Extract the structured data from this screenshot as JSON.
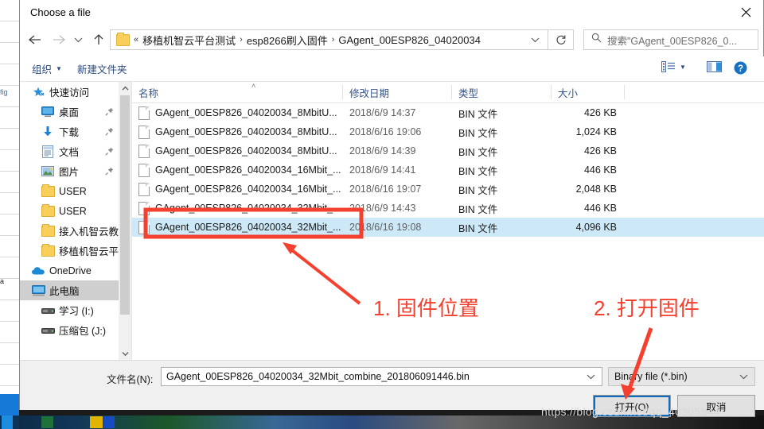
{
  "window": {
    "title": "Choose a file",
    "close_icon": "close-icon"
  },
  "nav": {
    "back_icon": "arrow-left-icon",
    "forward_icon": "arrow-right-icon",
    "history_icon": "chevron-down-icon",
    "up_icon": "arrow-up-icon",
    "refresh_icon": "refresh-icon",
    "breadcrumb": {
      "overflow": "«",
      "items": [
        "移植机智云平台测试",
        "esp8266刷入固件",
        "GAgent_00ESP826_04020034"
      ],
      "separator": "›",
      "dropdown_icon": "chevron-down-icon"
    },
    "search": {
      "icon": "search-icon",
      "text": "搜索\"GAgent_00ESP826_0..."
    }
  },
  "toolbar": {
    "organize": "组织",
    "organize_caret": "▼",
    "new_folder": "新建文件夹",
    "view_icon": "view-options-icon",
    "view_caret": "▼",
    "preview_pane_icon": "preview-pane-icon",
    "help_icon": "help-icon"
  },
  "sidebar": {
    "scrollbar": {
      "up_icon": "chevron-up-icon",
      "down_icon": "chevron-down-icon"
    },
    "items": [
      {
        "label": "快速访问",
        "icon": "quick-access-star-icon",
        "indent": 0,
        "pinned": false,
        "selected": false
      },
      {
        "label": "桌面",
        "icon": "desktop-icon",
        "indent": 1,
        "pinned": true,
        "selected": false
      },
      {
        "label": "下载",
        "icon": "downloads-icon",
        "indent": 1,
        "pinned": true,
        "selected": false
      },
      {
        "label": "文档",
        "icon": "documents-icon",
        "indent": 1,
        "pinned": true,
        "selected": false
      },
      {
        "label": "图片",
        "icon": "pictures-icon",
        "indent": 1,
        "pinned": true,
        "selected": false
      },
      {
        "label": "USER",
        "icon": "folder-icon",
        "indent": 1,
        "pinned": false,
        "selected": false
      },
      {
        "label": "USER",
        "icon": "folder-icon",
        "indent": 1,
        "pinned": false,
        "selected": false
      },
      {
        "label": "接入机智云教程",
        "icon": "folder-icon",
        "indent": 1,
        "pinned": false,
        "selected": false
      },
      {
        "label": "移植机智云平台测",
        "icon": "folder-icon",
        "indent": 1,
        "pinned": false,
        "selected": false
      },
      {
        "label": "OneDrive",
        "icon": "onedrive-cloud-icon",
        "indent": 0,
        "pinned": false,
        "selected": false
      },
      {
        "label": "此电脑",
        "icon": "this-pc-icon",
        "indent": 0,
        "pinned": false,
        "selected": true
      },
      {
        "label": "学习 (I:)",
        "icon": "drive-icon",
        "indent": 1,
        "pinned": false,
        "selected": false
      },
      {
        "label": "压缩包 (J:)",
        "icon": "drive-icon",
        "indent": 1,
        "pinned": false,
        "selected": false
      }
    ]
  },
  "filelist": {
    "columns": [
      "名称",
      "修改日期",
      "类型",
      "大小"
    ],
    "sort_caret": "˄",
    "rows": [
      {
        "name": "GAgent_00ESP826_04020034_8MbitU...",
        "date": "2018/6/9 14:37",
        "type": "BIN 文件",
        "size": "426 KB",
        "selected": false
      },
      {
        "name": "GAgent_00ESP826_04020034_8MbitU...",
        "date": "2018/6/16 19:06",
        "type": "BIN 文件",
        "size": "1,024 KB",
        "selected": false
      },
      {
        "name": "GAgent_00ESP826_04020034_8MbitU...",
        "date": "2018/6/9 14:39",
        "type": "BIN 文件",
        "size": "426 KB",
        "selected": false
      },
      {
        "name": "GAgent_00ESP826_04020034_16Mbit_...",
        "date": "2018/6/9 14:41",
        "type": "BIN 文件",
        "size": "446 KB",
        "selected": false
      },
      {
        "name": "GAgent_00ESP826_04020034_16Mbit_...",
        "date": "2018/6/16 19:07",
        "type": "BIN 文件",
        "size": "2,048 KB",
        "selected": false
      },
      {
        "name": "GAgent_00ESP826_04020034_32Mbit_...",
        "date": "2018/6/9 14:43",
        "type": "BIN 文件",
        "size": "446 KB",
        "selected": false
      },
      {
        "name": "GAgent_00ESP826_04020034_32Mbit_...",
        "date": "2018/6/16 19:08",
        "type": "BIN 文件",
        "size": "4,096 KB",
        "selected": true
      }
    ]
  },
  "bottom": {
    "filename_label": "文件名(N):",
    "filename_value": "GAgent_00ESP826_04020034_32Mbit_combine_201806091446.bin",
    "filename_caret": "chevron-down-icon",
    "filetype_value": "Binary file (*.bin)",
    "filetype_caret": "chevron-down-icon",
    "open_button": "打开(O)",
    "cancel_button": "取消"
  },
  "annotations": {
    "note1": "1. 固件位置",
    "note2": "2. 打开固件",
    "accent_color": "#f4402e"
  },
  "watermark": "https://blog.csdn.net/qq_40305944"
}
